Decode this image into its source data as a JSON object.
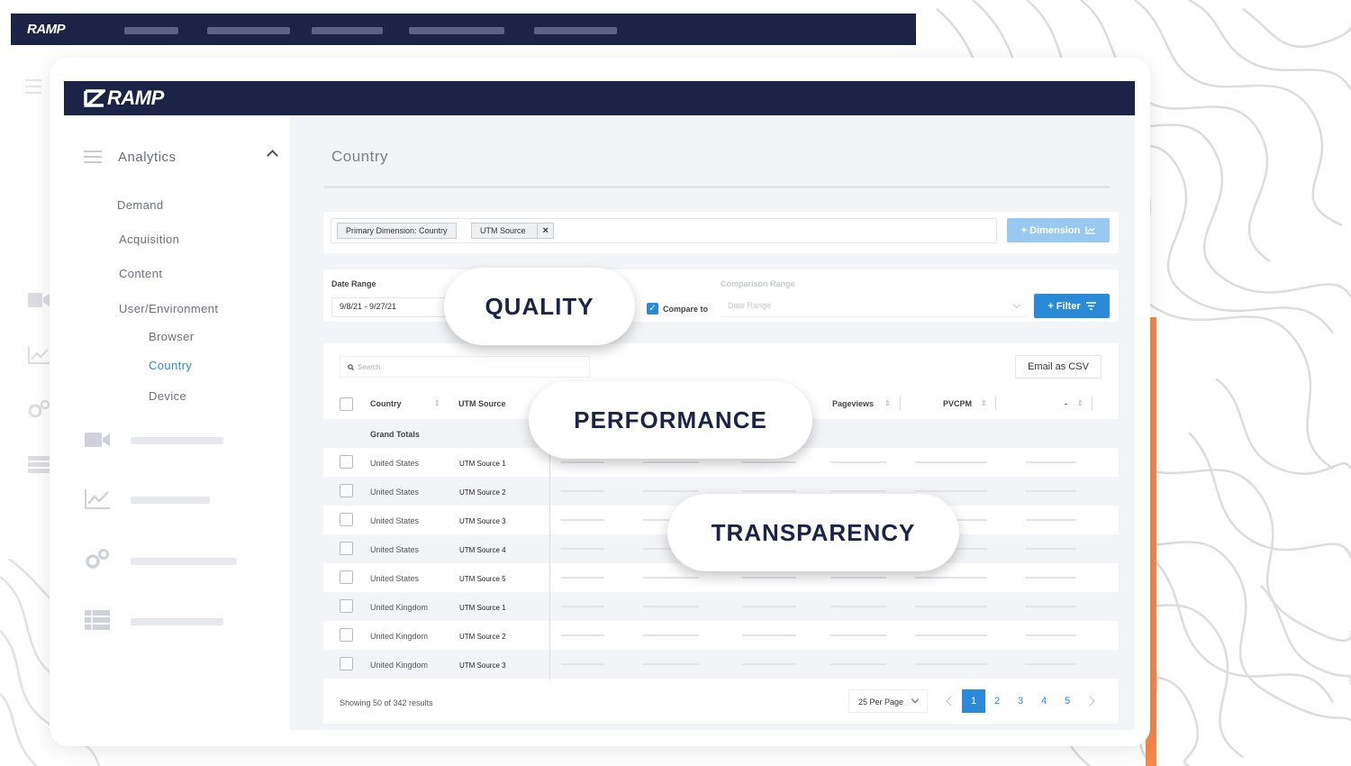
{
  "brand": {
    "logo_text": "RAMP"
  },
  "colors": {
    "navy": "#1b2446",
    "accent_blue": "#2b8ad8",
    "light_blue": "#99c9f1",
    "orange": "#f4874b"
  },
  "sidebar": {
    "section_title": "Analytics",
    "items": [
      {
        "label": "Demand"
      },
      {
        "label": "Acquisition"
      },
      {
        "label": "Content"
      },
      {
        "label": "User/Environment"
      }
    ],
    "subitems": [
      {
        "label": "Browser"
      },
      {
        "label": "Country",
        "active": true
      },
      {
        "label": "Device"
      }
    ],
    "collapsed_icons": [
      "video-icon",
      "chart-icon",
      "gears-icon",
      "table-icon"
    ]
  },
  "page": {
    "title": "Country"
  },
  "dimensions": {
    "chips": [
      {
        "label": "Primary Dimension: Country"
      },
      {
        "label": "UTM Source",
        "removable": true,
        "remove_glyph": "×"
      }
    ],
    "add_button": "+ Dimension"
  },
  "date_range": {
    "label": "Date Range",
    "value": "9/8/21 - 9/27/21",
    "compare_label": "Compare to",
    "compare_checked": true,
    "comparison_label": "Comparison Range",
    "comparison_placeholder": "Date Range",
    "filter_button": "+ Filter"
  },
  "table": {
    "search_placeholder": "Search",
    "email_button": "Email as CSV",
    "columns": [
      "Country",
      "UTM Source",
      "Pageviews",
      "PVCPM",
      "-"
    ],
    "grand_totals_label": "Grand Totals",
    "rows": [
      {
        "country": "United States",
        "source": "UTM Source 1"
      },
      {
        "country": "United States",
        "source": "UTM Source 2"
      },
      {
        "country": "United States",
        "source": "UTM Source 3"
      },
      {
        "country": "United States",
        "source": "UTM Source 4"
      },
      {
        "country": "United States",
        "source": "UTM Source 5"
      },
      {
        "country": "United Kingdom",
        "source": "UTM Source 1"
      },
      {
        "country": "United Kingdom",
        "source": "UTM Source 2"
      },
      {
        "country": "United Kingdom",
        "source": "UTM Source 3"
      }
    ],
    "results_text": "Showing 50 of 342 results",
    "per_page": "25 Per Page",
    "pages": [
      "1",
      "2",
      "3",
      "4",
      "5"
    ],
    "current_page": "1"
  },
  "overlays": {
    "quality": "QUALITY",
    "performance": "PERFORMANCE",
    "transparency": "TRANSPARENCY"
  }
}
